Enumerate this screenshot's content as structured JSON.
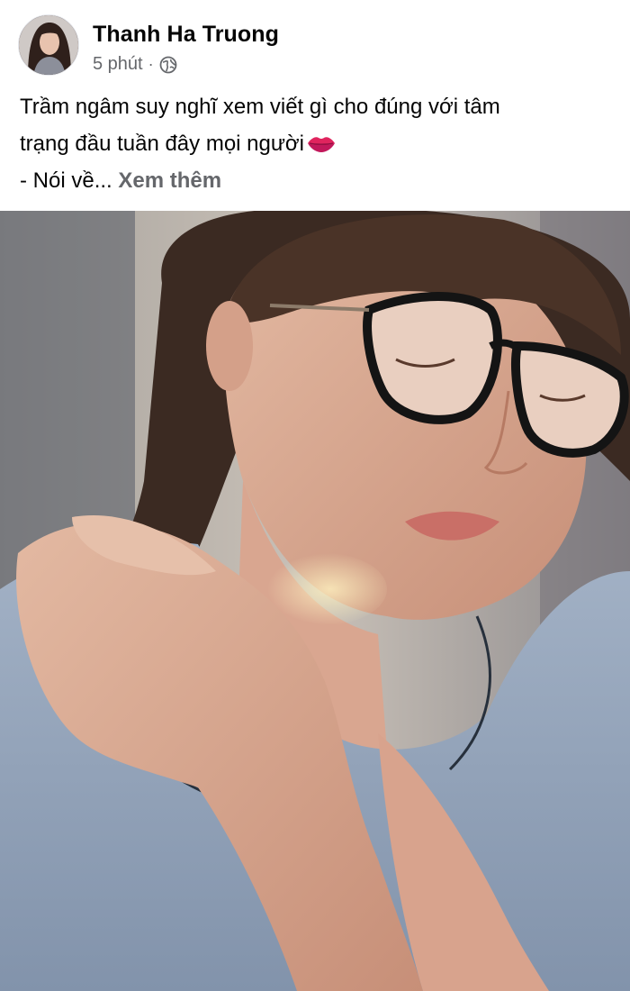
{
  "post": {
    "author_name": "Thanh Ha Truong",
    "timestamp": "5 phút",
    "separator": "·",
    "audience_icon": "globe-icon",
    "text_line_1": "Trầm ngâm suy nghĩ xem viết gì cho đúng với tâm",
    "text_line_2": "trạng đầu tuần đây mọi người",
    "text_line_3_prefix": "- Nói về...",
    "see_more_label": "Xem thêm",
    "emoji_icon": "lips-icon"
  },
  "colors": {
    "primary_text": "#050505",
    "secondary_text": "#65676b",
    "background": "#ffffff"
  }
}
